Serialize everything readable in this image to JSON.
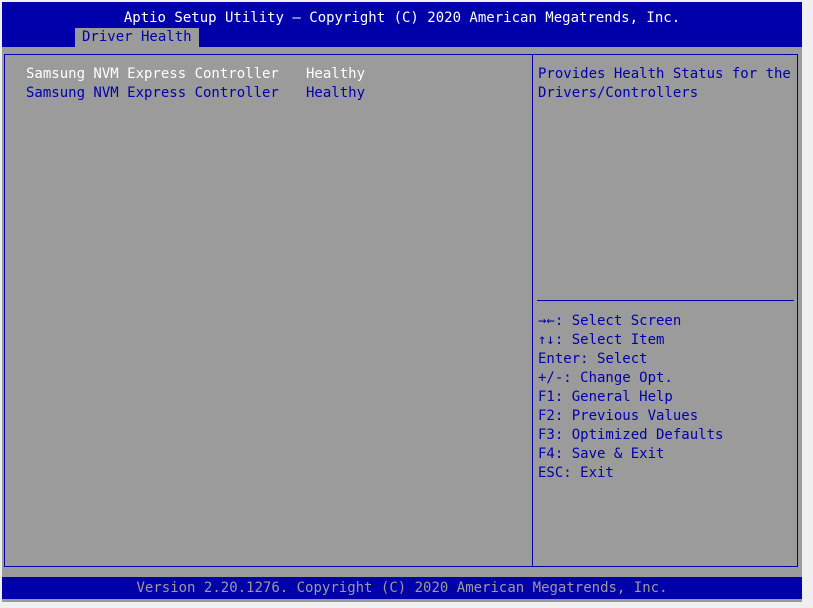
{
  "header": {
    "title": "Aptio Setup Utility – Copyright (C) 2020 American Megatrends, Inc.",
    "tab": "Driver Health"
  },
  "main": {
    "items": [
      {
        "label": "Samsung NVM Express Controller",
        "status": "Healthy"
      },
      {
        "label": "Samsung NVM Express Controller",
        "status": "Healthy"
      }
    ]
  },
  "help": {
    "text": "Provides Health Status for the Drivers/Controllers"
  },
  "keys": [
    "→←: Select Screen",
    "↑↓: Select Item",
    "Enter: Select",
    "+/-: Change Opt.",
    "F1: General Help",
    "F2: Previous Values",
    "F3: Optimized Defaults",
    "F4: Save & Exit",
    "ESC: Exit"
  ],
  "footer": {
    "text": "Version 2.20.1276. Copyright (C) 2020 American Megatrends, Inc."
  },
  "colors": {
    "bios_blue": "#0000aa",
    "bios_gray": "#9b9b9b",
    "highlight_text": "#ffffff"
  }
}
